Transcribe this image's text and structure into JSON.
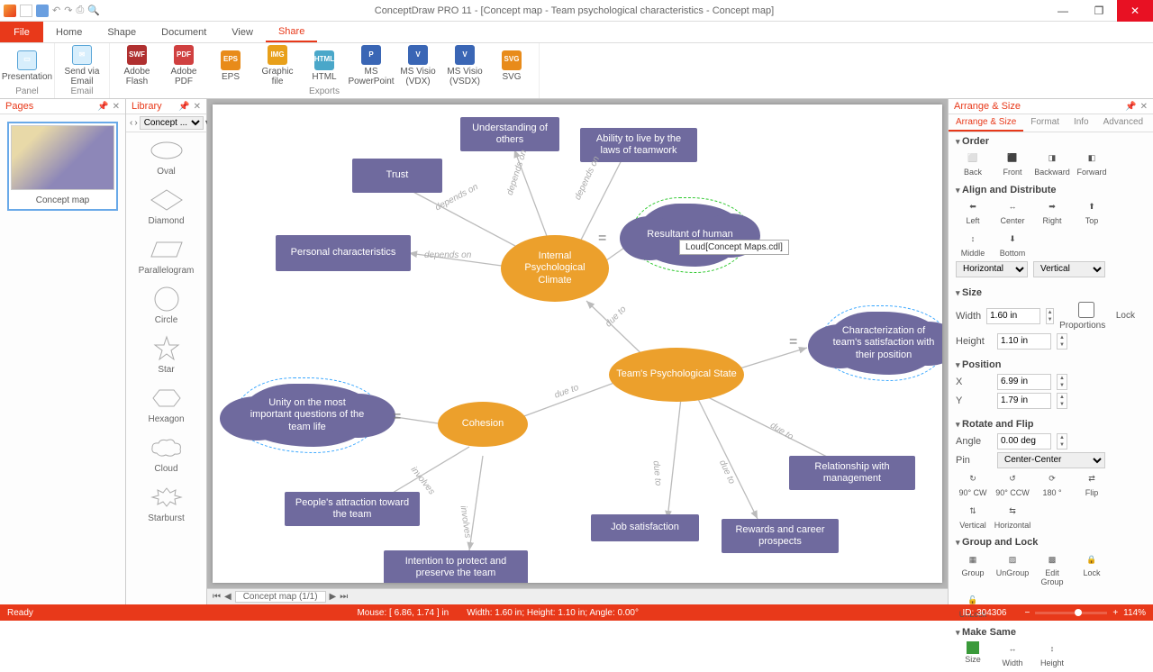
{
  "app": {
    "title": "ConceptDraw PRO 11 - [Concept map - Team psychological characteristics - Concept map]"
  },
  "tabs": {
    "file": "File",
    "items": [
      "Home",
      "Shape",
      "Document",
      "View",
      "Share"
    ],
    "active": "Share"
  },
  "ribbon": {
    "groups": [
      {
        "label": "Panel",
        "buttons": [
          {
            "label": "Presentation",
            "color": "#5aa6d8"
          }
        ]
      },
      {
        "label": "Email",
        "buttons": [
          {
            "label": "Send via Email",
            "color": "#5aa6d8"
          }
        ]
      },
      {
        "label": "Exports",
        "buttons": [
          {
            "label": "Adobe Flash",
            "color": "#b03030",
            "tag": "SWF"
          },
          {
            "label": "Adobe PDF",
            "color": "#d04040",
            "tag": "PDF"
          },
          {
            "label": "EPS",
            "color": "#e88b1a",
            "tag": "EPS"
          },
          {
            "label": "Graphic file",
            "color": "#e8a01a",
            "tag": "IMG"
          },
          {
            "label": "HTML",
            "color": "#4aa7c9",
            "tag": "HTML"
          },
          {
            "label": "MS PowerPoint",
            "color": "#3a66b5",
            "tag": "P"
          },
          {
            "label": "MS Visio (VDX)",
            "color": "#3a66b5",
            "tag": "V"
          },
          {
            "label": "MS Visio (VSDX)",
            "color": "#3a66b5",
            "tag": "V"
          },
          {
            "label": "SVG",
            "color": "#e88b1a",
            "tag": "SVG"
          }
        ]
      }
    ]
  },
  "pages": {
    "title": "Pages",
    "thumb": "Concept map"
  },
  "library": {
    "title": "Library",
    "dropdown": "Concept ...",
    "shapes": [
      "Oval",
      "Diamond",
      "Parallelogram",
      "Circle",
      "Star",
      "Hexagon",
      "Cloud",
      "Starburst"
    ]
  },
  "canvas": {
    "tooltip": "Loud[Concept Maps.cdl]",
    "nodes": {
      "trust": "Trust",
      "understanding": "Understanding of others",
      "ability": "Ability to live by the laws of teamwork",
      "personal": "Personal characteristics",
      "internal": "Internal Psychological Climate",
      "resultant": "Resultant of human",
      "team": "Team's Psychological State",
      "characterization": "Characterization of team's satisfaction with their position",
      "cohesion": "Cohesion",
      "unity": "Unity on the most important questions of the team life",
      "attraction": "People's attraction toward the team",
      "intention": "Intention to protect and preserve the team",
      "jobsat": "Job satisfaction",
      "rewards": "Rewards and career prospects",
      "relationship": "Relationship with management"
    },
    "edgelabels": {
      "depends": "depends on",
      "dueto": "due to",
      "involves": "involves"
    },
    "pagetab": "Concept map (1/1)"
  },
  "arrange": {
    "title": "Arrange & Size",
    "subtabs": [
      "Arrange & Size",
      "Format",
      "Info",
      "Advanced"
    ],
    "order": {
      "title": "Order",
      "items": [
        "Back",
        "Front",
        "Backward",
        "Forward"
      ]
    },
    "align": {
      "title": "Align and Distribute",
      "items": [
        "Left",
        "Center",
        "Right",
        "Top",
        "Middle",
        "Bottom"
      ],
      "h": "Horizontal",
      "v": "Vertical"
    },
    "size": {
      "title": "Size",
      "width_label": "Width",
      "width": "1.60 in",
      "height_label": "Height",
      "height": "1.10 in",
      "lock": "Lock Proportions"
    },
    "position": {
      "title": "Position",
      "x_label": "X",
      "x": "6.99 in",
      "y_label": "Y",
      "y": "1.79 in"
    },
    "rotate": {
      "title": "Rotate and Flip",
      "angle_label": "Angle",
      "angle": "0.00 deg",
      "pin_label": "Pin",
      "pin": "Center-Center",
      "items": [
        "90° CW",
        "90° CCW",
        "180 °",
        "Flip",
        "Vertical",
        "Horizontal"
      ]
    },
    "group": {
      "title": "Group and Lock",
      "items": [
        "Group",
        "UnGroup",
        "Edit Group",
        "Lock",
        "UnLock"
      ]
    },
    "same": {
      "title": "Make Same",
      "items": [
        "Size",
        "Width",
        "Height"
      ]
    }
  },
  "status": {
    "ready": "Ready",
    "mouse": "Mouse: [ 6.86, 1.74 ] in",
    "dims": "Width: 1.60 in;  Height: 1.10 in;  Angle: 0.00°",
    "id": "ID: 304306",
    "zoom": "114%"
  }
}
